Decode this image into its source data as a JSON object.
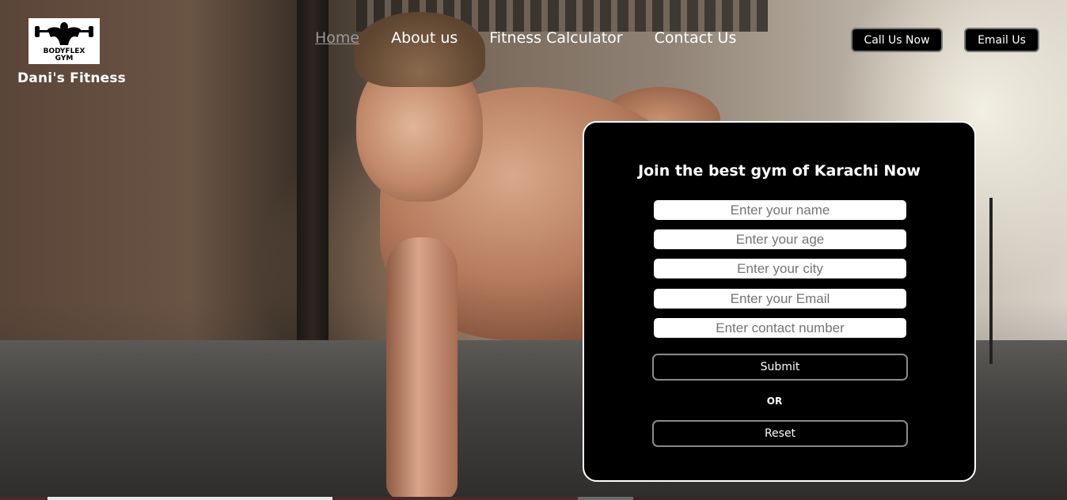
{
  "header": {
    "logo_text_line1": "BODYFLEX",
    "logo_text_line2": "GYM",
    "brand_name": "Dani's Fitness",
    "nav": [
      {
        "label": "Home",
        "active": true
      },
      {
        "label": "About us",
        "active": false
      },
      {
        "label": "Fitness Calculator",
        "active": false
      },
      {
        "label": "Contact Us",
        "active": false
      }
    ],
    "call_button": "Call Us Now",
    "email_button": "Email Us"
  },
  "form": {
    "title": "Join the best gym of Karachi Now",
    "fields": [
      {
        "name": "name",
        "placeholder": "Enter your name",
        "value": ""
      },
      {
        "name": "age",
        "placeholder": "Enter your age",
        "value": ""
      },
      {
        "name": "city",
        "placeholder": "Enter your city",
        "value": ""
      },
      {
        "name": "email",
        "placeholder": "Enter your Email",
        "value": ""
      },
      {
        "name": "contact",
        "placeholder": "Enter contact number",
        "value": ""
      }
    ],
    "submit_label": "Submit",
    "or_label": "OR",
    "reset_label": "Reset"
  },
  "colors": {
    "form_background": "#000000",
    "form_border": "#ffffff",
    "nav_active": "#9a9a9a",
    "text": "#ffffff"
  }
}
